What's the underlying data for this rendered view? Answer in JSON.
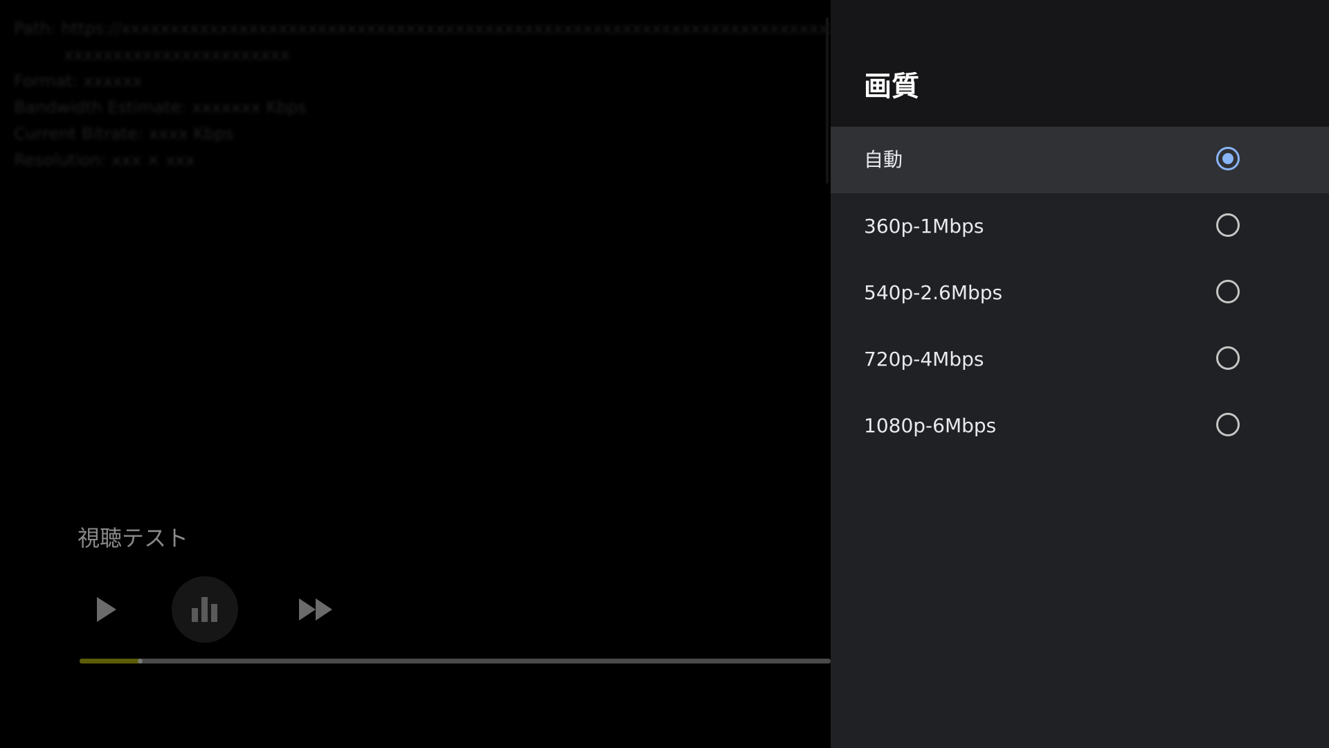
{
  "player": {
    "debug_lines": [
      "Path: https://xxxxxxxxxxxxxxxxxxxxxxxxxxxxxxxxxxxxxxxxxxxxxxxxxxxxxxxxxxxxxxxxxxxxxxxxxxxxxx",
      "xxxxxxxxxxxxxxxxxxxxxxx",
      "Format: xxxxxx",
      "Bandwidth Estimate: xxxxxxx Kbps",
      "Current Bitrate: xxxx Kbps",
      "Resolution: xxx × xxx"
    ],
    "video_title": "視聴テスト",
    "play_icon": "play-icon",
    "stats_icon": "bar-chart-icon",
    "ff_icon": "fast-forward-icon",
    "progress": 0.08,
    "progress_color": "#5c5d08"
  },
  "quality_panel": {
    "title": "画質",
    "options": [
      {
        "label": "自動",
        "selected": true
      },
      {
        "label": "360p-1Mbps",
        "selected": false
      },
      {
        "label": "540p-2.6Mbps",
        "selected": false
      },
      {
        "label": "720p-4Mbps",
        "selected": false
      },
      {
        "label": "1080p-6Mbps",
        "selected": false
      }
    ],
    "accent_color": "#8ab4f8"
  }
}
